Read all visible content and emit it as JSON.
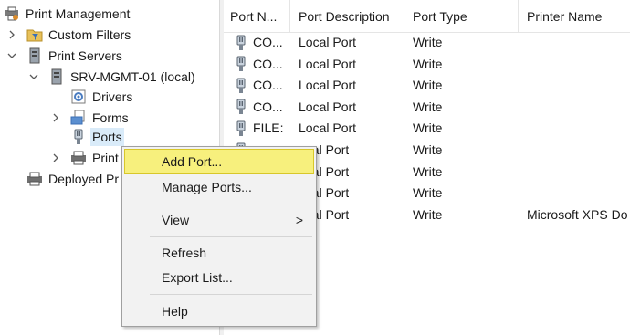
{
  "tree": {
    "root": "Print Management",
    "custom_filters": "Custom Filters",
    "print_servers": "Print Servers",
    "server": "SRV-MGMT-01 (local)",
    "drivers": "Drivers",
    "forms": "Forms",
    "ports": "Ports",
    "printers": "Print",
    "deployed": "Deployed Pr"
  },
  "list": {
    "columns": [
      "Port N...",
      "Port Description",
      "Port Type",
      "Printer Name"
    ],
    "rows": [
      {
        "name": "CO...",
        "description": "Local Port",
        "type": "Write",
        "printer": ""
      },
      {
        "name": "CO...",
        "description": "Local Port",
        "type": "Write",
        "printer": ""
      },
      {
        "name": "CO...",
        "description": "Local Port",
        "type": "Write",
        "printer": ""
      },
      {
        "name": "CO...",
        "description": "Local Port",
        "type": "Write",
        "printer": ""
      },
      {
        "name": "FILE:",
        "description": "Local Port",
        "type": "Write",
        "printer": ""
      },
      {
        "name": "",
        "description": "ocal Port",
        "type": "Write",
        "printer": ""
      },
      {
        "name": "",
        "description": "ocal Port",
        "type": "Write",
        "printer": ""
      },
      {
        "name": "",
        "description": "ocal Port",
        "type": "Write",
        "printer": ""
      },
      {
        "name": "",
        "description": "ocal Port",
        "type": "Write",
        "printer": "Microsoft XPS Do"
      }
    ]
  },
  "context_menu": {
    "items": [
      "Add Port...",
      "Manage Ports...",
      "View",
      "Refresh",
      "Export List...",
      "Help"
    ],
    "submenu_arrow": ">"
  },
  "colors": {
    "menu_highlight": "#f7f07d",
    "selection": "#d9ebf9"
  }
}
